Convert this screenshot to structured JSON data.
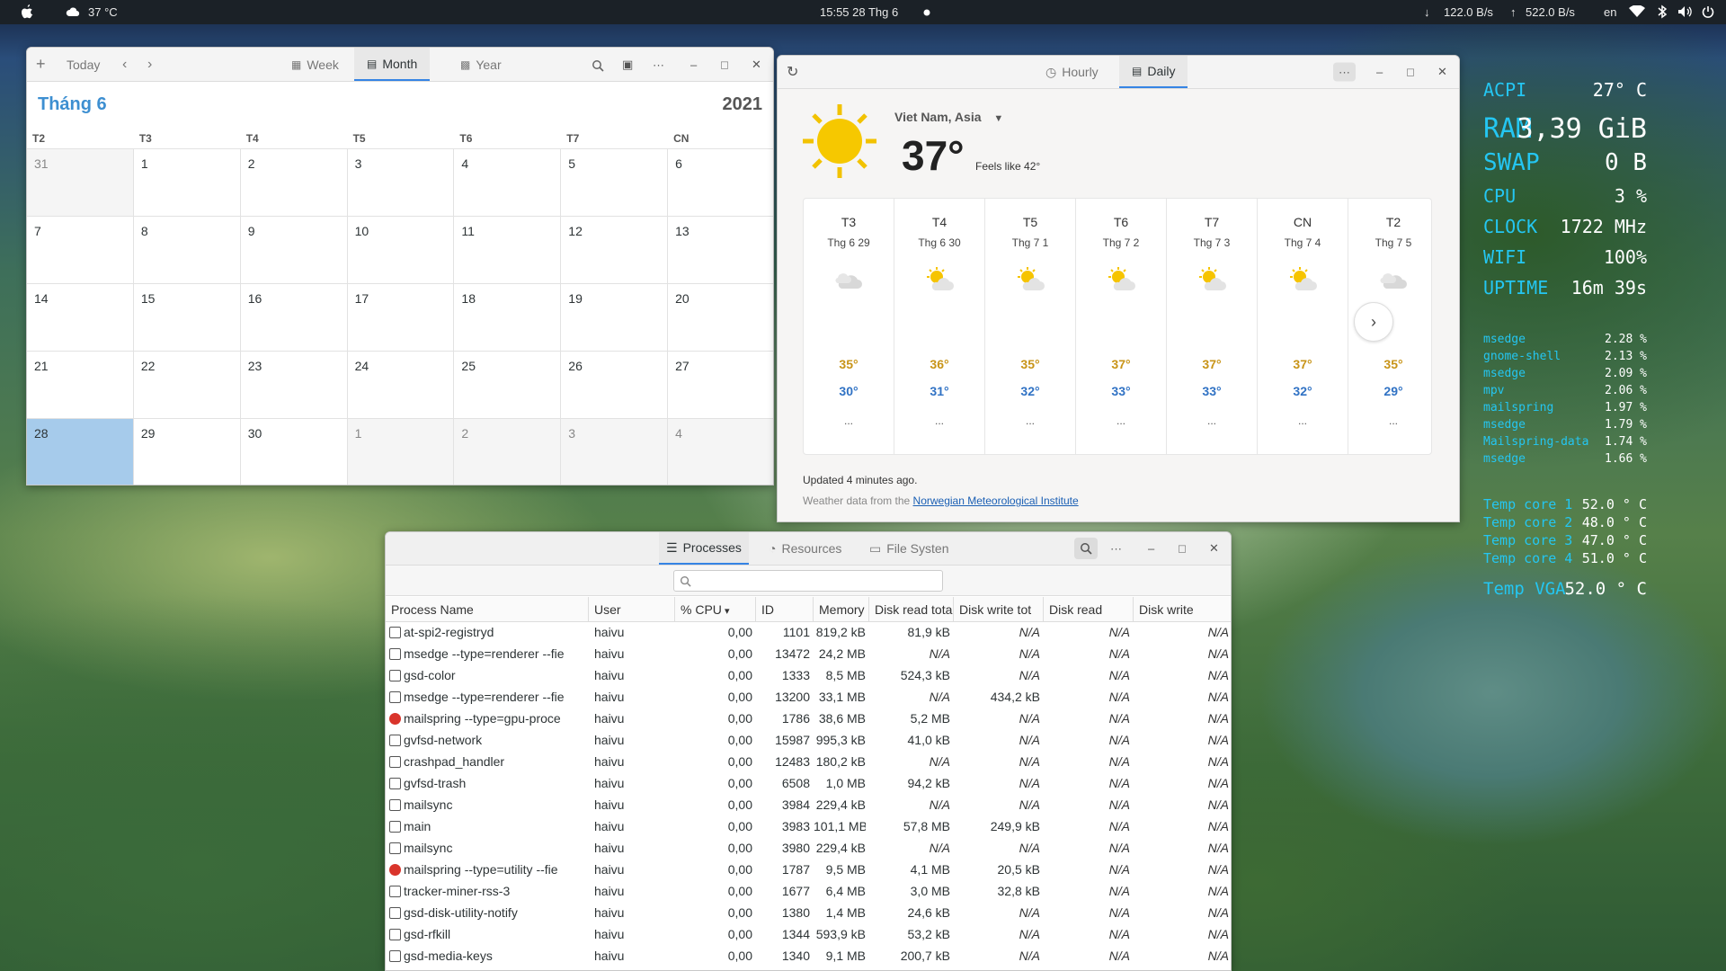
{
  "topbar": {
    "weather": "37 °C",
    "clock": "15:55  28 Thg 6",
    "net_down": "122.0  B/s",
    "net_up": "522.0  B/s",
    "lang": "en"
  },
  "calendar": {
    "toolbar": {
      "add": "+",
      "today": "Today",
      "week": "Week",
      "month": "Month",
      "year": "Year"
    },
    "month_title": "Tháng 6",
    "year": "2021",
    "weekdays": [
      "T2",
      "T3",
      "T4",
      "T5",
      "T6",
      "T7",
      "CN"
    ],
    "weeks": [
      [
        "31",
        "1",
        "2",
        "3",
        "4",
        "5",
        "6"
      ],
      [
        "7",
        "8",
        "9",
        "10",
        "11",
        "12",
        "13"
      ],
      [
        "14",
        "15",
        "16",
        "17",
        "18",
        "19",
        "20"
      ],
      [
        "21",
        "22",
        "23",
        "24",
        "25",
        "26",
        "27"
      ],
      [
        "28",
        "29",
        "30",
        "1",
        "2",
        "3",
        "4"
      ]
    ]
  },
  "weather": {
    "tabs": {
      "hourly": "Hourly",
      "daily": "Daily"
    },
    "location": "Viet Nam, Asia",
    "temp": "37°",
    "feels": "Feels like 42°",
    "days": [
      {
        "d": "T3",
        "dt": "Thg 6 29",
        "hi": "35°",
        "lo": "30°",
        "el": "..."
      },
      {
        "d": "T4",
        "dt": "Thg 6 30",
        "hi": "36°",
        "lo": "31°",
        "el": "..."
      },
      {
        "d": "T5",
        "dt": "Thg 7  1",
        "hi": "35°",
        "lo": "32°",
        "el": "..."
      },
      {
        "d": "T6",
        "dt": "Thg 7  2",
        "hi": "37°",
        "lo": "33°",
        "el": "..."
      },
      {
        "d": "T7",
        "dt": "Thg 7  3",
        "hi": "37°",
        "lo": "33°",
        "el": "..."
      },
      {
        "d": "CN",
        "dt": "Thg 7  4",
        "hi": "37°",
        "lo": "32°",
        "el": "..."
      },
      {
        "d": "T2",
        "dt": "Thg 7  5",
        "hi": "35°",
        "lo": "29°",
        "el": "..."
      }
    ],
    "updated": "Updated 4 minutes ago.",
    "source_prefix": "Weather data from the",
    "source_link": "Norwegian Meteorological Institute"
  },
  "sysmon": {
    "tabs": {
      "processes": "Processes",
      "resources": "Resources",
      "filesystems": "File Systen"
    },
    "columns": [
      "Process Name",
      "User",
      "% CPU",
      "ID",
      "Memory",
      "Disk read tota",
      "Disk write tot",
      "Disk read",
      "Disk write"
    ],
    "rows": [
      [
        "at-spi2-registryd",
        "haivu",
        "0,00",
        "1101",
        "819,2 kB",
        "81,9 kB",
        "N/A",
        "N/A",
        "N/A"
      ],
      [
        "msedge --type=renderer --fie",
        "haivu",
        "0,00",
        "13472",
        "24,2 MB",
        "N/A",
        "N/A",
        "N/A",
        "N/A"
      ],
      [
        "gsd-color",
        "haivu",
        "0,00",
        "1333",
        "8,5 MB",
        "524,3 kB",
        "N/A",
        "N/A",
        "N/A"
      ],
      [
        "msedge --type=renderer --fie",
        "haivu",
        "0,00",
        "13200",
        "33,1 MB",
        "N/A",
        "434,2 kB",
        "N/A",
        "N/A"
      ],
      [
        "mailspring --type=gpu-proce",
        "haivu",
        "0,00",
        "1786",
        "38,6 MB",
        "5,2 MB",
        "N/A",
        "N/A",
        "N/A"
      ],
      [
        "gvfsd-network",
        "haivu",
        "0,00",
        "15987",
        "995,3 kB",
        "41,0 kB",
        "N/A",
        "N/A",
        "N/A"
      ],
      [
        "crashpad_handler",
        "haivu",
        "0,00",
        "12483",
        "180,2 kB",
        "N/A",
        "N/A",
        "N/A",
        "N/A"
      ],
      [
        "gvfsd-trash",
        "haivu",
        "0,00",
        "6508",
        "1,0 MB",
        "94,2 kB",
        "N/A",
        "N/A",
        "N/A"
      ],
      [
        "mailsync",
        "haivu",
        "0,00",
        "3984",
        "229,4 kB",
        "N/A",
        "N/A",
        "N/A",
        "N/A"
      ],
      [
        "main",
        "haivu",
        "0,00",
        "3983",
        "101,1 MB",
        "57,8 MB",
        "249,9 kB",
        "N/A",
        "N/A"
      ],
      [
        "mailsync",
        "haivu",
        "0,00",
        "3980",
        "229,4 kB",
        "N/A",
        "N/A",
        "N/A",
        "N/A"
      ],
      [
        "mailspring --type=utility --fie",
        "haivu",
        "0,00",
        "1787",
        "9,5 MB",
        "4,1 MB",
        "20,5 kB",
        "N/A",
        "N/A"
      ],
      [
        "tracker-miner-rss-3",
        "haivu",
        "0,00",
        "1677",
        "6,4 MB",
        "3,0 MB",
        "32,8 kB",
        "N/A",
        "N/A"
      ],
      [
        "gsd-disk-utility-notify",
        "haivu",
        "0,00",
        "1380",
        "1,4 MB",
        "24,6 kB",
        "N/A",
        "N/A",
        "N/A"
      ],
      [
        "gsd-rfkill",
        "haivu",
        "0,00",
        "1344",
        "593,9 kB",
        "53,2 kB",
        "N/A",
        "N/A",
        "N/A"
      ],
      [
        "gsd-media-keys",
        "haivu",
        "0,00",
        "1340",
        "9,1 MB",
        "200,7 kB",
        "N/A",
        "N/A",
        "N/A"
      ]
    ],
    "row_icons": [
      "term",
      "term",
      "term",
      "term",
      "mail",
      "term",
      "term",
      "term",
      "term",
      "term",
      "term",
      "mail",
      "term",
      "term",
      "term",
      "term"
    ]
  },
  "conky": {
    "stats": [
      {
        "label": "ACPI",
        "value": "27° C"
      },
      {
        "label": "RAM",
        "value": "3,39 GiB"
      },
      {
        "label": "SWAP",
        "value": "0 B"
      },
      {
        "label": "CPU",
        "value": "3 %"
      },
      {
        "label": "CLOCK",
        "value": "1722 MHz"
      },
      {
        "label": "WIFI",
        "value": "100%"
      },
      {
        "label": "UPTIME",
        "value": "16m 39s"
      }
    ],
    "procs": [
      {
        "name": "msedge",
        "value": "2.28 %"
      },
      {
        "name": "gnome-shell",
        "value": "2.13 %"
      },
      {
        "name": "msedge",
        "value": "2.09 %"
      },
      {
        "name": "mpv",
        "value": "2.06 %"
      },
      {
        "name": "mailspring",
        "value": "1.97 %"
      },
      {
        "name": "msedge",
        "value": "1.79 %"
      },
      {
        "name": "Mailspring-data",
        "value": "1.74 %"
      },
      {
        "name": "msedge",
        "value": "1.66 %"
      }
    ],
    "temps": [
      {
        "label": "Temp core 1",
        "value": "52.0 ° C"
      },
      {
        "label": "Temp core 2",
        "value": "48.0 ° C"
      },
      {
        "label": "Temp core 3",
        "value": "47.0 ° C"
      },
      {
        "label": "Temp core 4",
        "value": "51.0 ° C"
      },
      {
        "label": "Temp VGA",
        "value": "52.0 ° C"
      }
    ]
  }
}
